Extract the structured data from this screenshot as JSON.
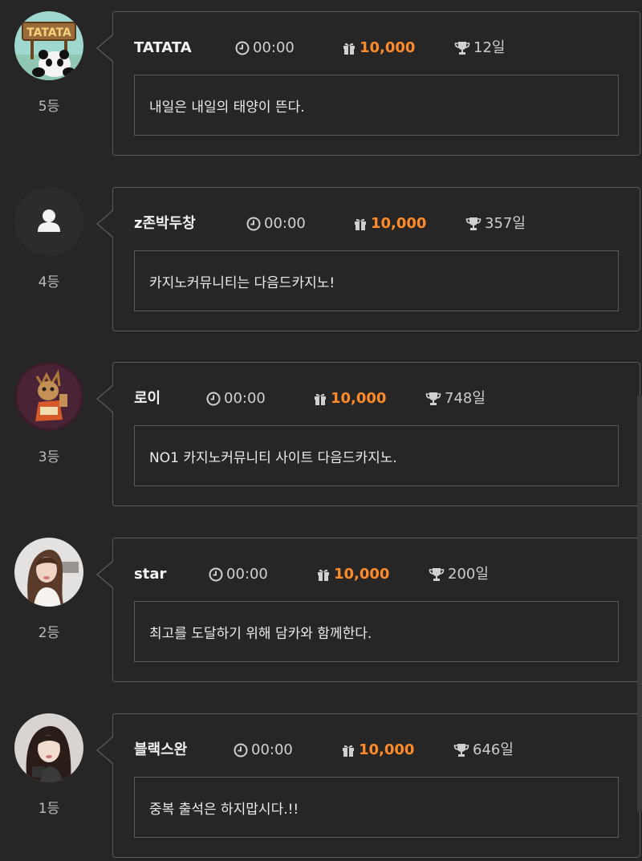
{
  "entries": [
    {
      "rank": "5등",
      "name": "TATATA",
      "time": "00:00",
      "points": "10,000",
      "days": "12일",
      "message": "내일은 내일의 태양이 뜬다.",
      "avatar": "panda-tatata-avatar"
    },
    {
      "rank": "4등",
      "name": "z존박두창",
      "time": "00:00",
      "points": "10,000",
      "days": "357일",
      "message": "카지노커뮤니티는 다음드카지노!",
      "avatar": "default-user-avatar"
    },
    {
      "rank": "3등",
      "name": "로이",
      "time": "00:00",
      "points": "10,000",
      "days": "748일",
      "message": "NO1 카지노커뮤니티 사이트 다음드카지노.",
      "avatar": "character-avatar"
    },
    {
      "rank": "2등",
      "name": "star",
      "time": "00:00",
      "points": "10,000",
      "days": "200일",
      "message": "최고를 도달하기 위해 담카와 함께한다.",
      "avatar": "woman-photo-avatar"
    },
    {
      "rank": "1등",
      "name": "블랙스완",
      "time": "00:00",
      "points": "10,000",
      "days": "646일",
      "message": "중복 출석은 하지맙시다.!!",
      "avatar": "woman-photo-avatar"
    }
  ],
  "colors": {
    "background": "#262626",
    "border": "#5a5a5a",
    "points": "#ff8a2a"
  },
  "icons": {
    "time": "clock-icon",
    "points": "gift-icon",
    "days": "trophy-icon"
  }
}
